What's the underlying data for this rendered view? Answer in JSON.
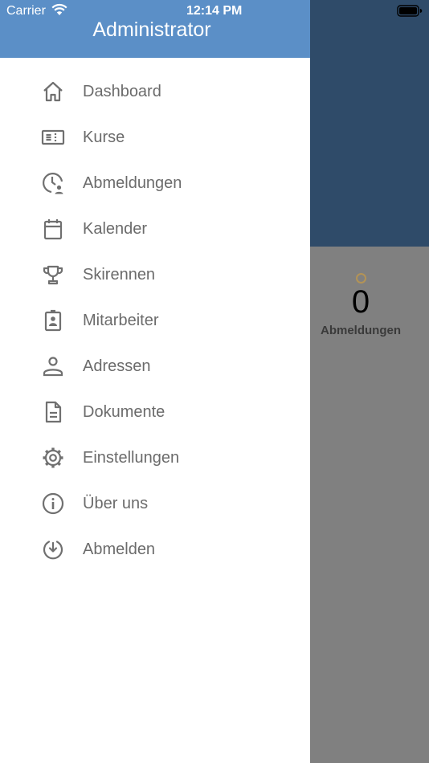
{
  "status_bar": {
    "carrier": "Carrier",
    "time": "12:14 PM"
  },
  "drawer": {
    "title": "Administrator"
  },
  "menu": {
    "items": [
      {
        "label": "Dashboard",
        "icon": "home-icon"
      },
      {
        "label": "Kurse",
        "icon": "course-ticket-icon"
      },
      {
        "label": "Abmeldungen",
        "icon": "clock-person-icon"
      },
      {
        "label": "Kalender",
        "icon": "calendar-icon"
      },
      {
        "label": "Skirennen",
        "icon": "trophy-icon"
      },
      {
        "label": "Mitarbeiter",
        "icon": "badge-icon"
      },
      {
        "label": "Adressen",
        "icon": "person-icon"
      },
      {
        "label": "Dokumente",
        "icon": "document-icon"
      },
      {
        "label": "Einstellungen",
        "icon": "gear-icon"
      },
      {
        "label": "Über uns",
        "icon": "info-icon"
      },
      {
        "label": "Abmelden",
        "icon": "logout-icon"
      }
    ]
  },
  "background": {
    "stat": {
      "value": "0",
      "label": "Abmeldungen"
    }
  },
  "colors": {
    "header": "#5b8fc7",
    "main_header_dimmed": "#2f4b69",
    "overlay_gray": "#808080",
    "menu_text": "#6b6b6b",
    "menu_icon": "#707070",
    "ring_accent": "#b39356"
  }
}
